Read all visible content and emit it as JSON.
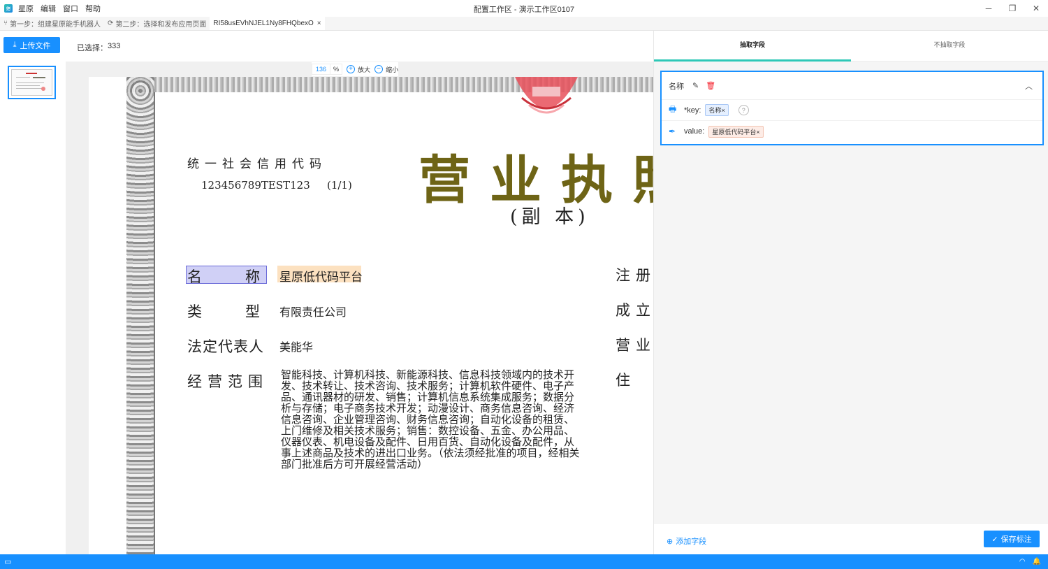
{
  "app": {
    "menu": [
      "星原",
      "编辑",
      "窗口",
      "帮助"
    ],
    "window_title": "配置工作区 - 演示工作区0107",
    "logo_icon": "app-logo-icon"
  },
  "tabs": [
    {
      "icon": "⑂",
      "label": "第一步：组建星原能手机器人"
    },
    {
      "icon": "⟳",
      "label": "第二步：选择和发布应用页面"
    },
    {
      "label": "RI58usEVhNJEL1Ny8FHQbexO",
      "close": "×"
    }
  ],
  "toolbar": {
    "upload_label": "上传文件",
    "selected_label": "已选择：",
    "selected_count": "333"
  },
  "zoom": {
    "value": "136",
    "unit": "%",
    "zoom_in": "放大",
    "zoom_out": "缩小"
  },
  "document": {
    "uscc_label": "统一社会信用代码",
    "uscc_code": "123456789TEST123",
    "uscc_page": "(1/1)",
    "title": "营业执照",
    "subtitle": "(副 本)",
    "fields": [
      {
        "label": "名称",
        "value": "星原低代码平台"
      },
      {
        "label": "类型",
        "value": "有限责任公司"
      },
      {
        "label": "法定代表人",
        "value": "美能华"
      },
      {
        "label": "经营范围",
        "value": "智能科技、计算机科技、新能源科技、信息科技领域内的技术开发、技术转让、技术咨询、技术服务；计算机软件硬件、电子产品、通讯器材的研发、销售；计算机信息系统集成服务；数据分析与存储；电子商务技术开发；动漫设计、商务信息咨询、经济信息咨询、企业管理咨询、财务信息咨询；自动化设备的租赁、上门维修及相关技术服务；销售：数控设备、五金、办公用品、仪器仪表、机电设备及配件、日用百货、自动化设备及配件，从事上述商品及技术的进出口业务。（依法须经批准的项目，经相关部门批准后方可开展经营活动）"
      }
    ],
    "right_labels": [
      "注册",
      "成立",
      "营业",
      "住"
    ]
  },
  "right_panel": {
    "tabs": [
      "抽取字段",
      "不抽取字段"
    ],
    "field": {
      "name": "名称",
      "key_label": "*key:",
      "key_tag": "名称",
      "value_label": "value:",
      "value_tag": "星原低代码平台",
      "tag_close": "×",
      "help": "?"
    },
    "add_field": "添加字段",
    "save": "保存标注"
  },
  "status": {
    "left_icon": "monitor-icon",
    "right_icons": [
      "wifi-icon",
      "bell-icon"
    ]
  },
  "colors": {
    "accent": "#1890ff",
    "tab_underline": "#2ec8b7",
    "title_olive": "#6e6416",
    "danger": "#f5222d"
  }
}
